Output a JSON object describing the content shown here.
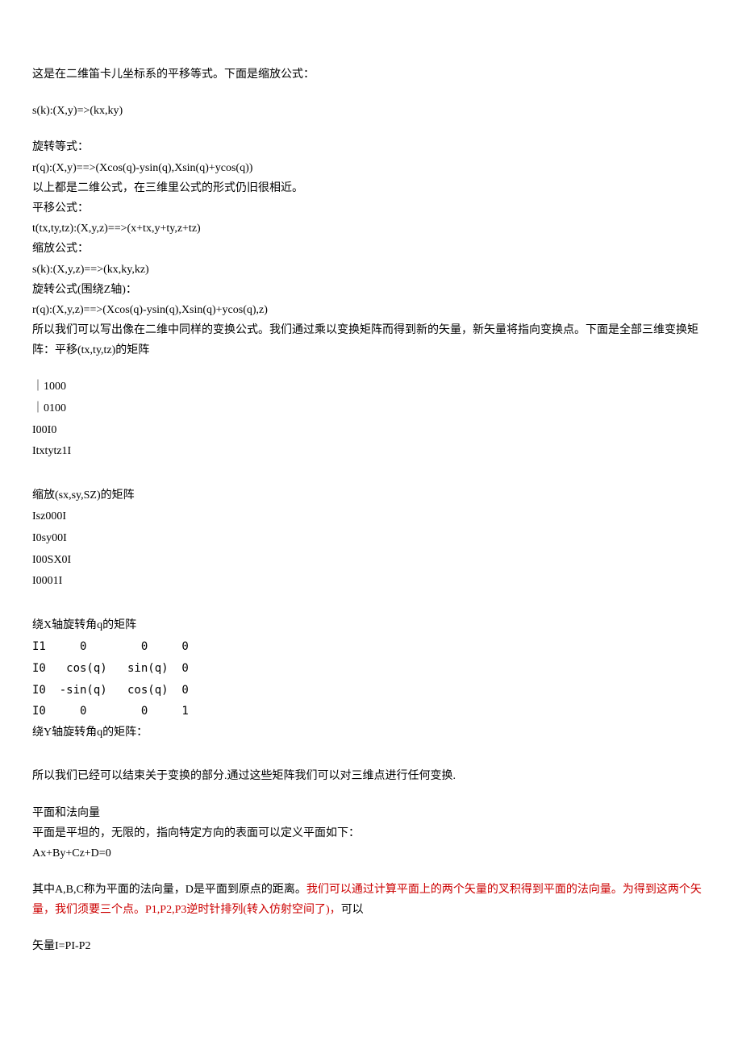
{
  "p1": "这是在二维笛卡儿坐标系的平移等式。下面是缩放公式：",
  "p2": "s(k):(X,y)=>(kx,ky)",
  "p3a": "旋转等式：",
  "p3b": "r(q):(X,y)==>(Xcos(q)-ysin(q),Xsin(q)+ycos(q))",
  "p3c": "以上都是二维公式，在三维里公式的形式仍旧很相近。",
  "p3d": "平移公式：",
  "p3e": "t(tx,ty,tz):(X,y,z)==>(x+tx,y+ty,z+tz)",
  "p3f": "缩放公式：",
  "p3g": "s(k):(X,y,z)==>(kx,ky,kz)",
  "p3h": "旋转公式(围绕Z轴)：",
  "p3i": "r(q):(X,y,z)==>(Xcos(q)-ysin(q),Xsin(q)+ycos(q),z)",
  "p3j": "所以我们可以写出像在二维中同样的变换公式。我们通过乘以变换矩阵而得到新的矢量，新矢量将指向变换点。下面是全部三维变换矩阵：平移(tx,ty,tz)的矩阵",
  "m1a": "｜1000",
  "m1b": "｜0100",
  "m1c": "I00I0",
  "m1d": "Itxtytz1I",
  "p4": "缩放(sx,sy,SZ)的矩阵",
  "m2a": "Isz000I",
  "m2b": "I0sy00I",
  "m2c": "I00SX0I",
  "m2d": "I0001I",
  "p5": "绕X轴旋转角q的矩阵",
  "m3a": "I1     0        0     0",
  "m3b": "I0   cos(q)   sin(q)  0",
  "m3c": "I0  -sin(q)   cos(q)  0",
  "m3d": "I0     0        0     1",
  "p6": "绕Y轴旋转角q的矩阵：",
  "p7": "所以我们已经可以结束关于变换的部分.通过这些矩阵我们可以对三维点进行任何变换.",
  "p8a": "平面和法向量",
  "p8b": "平面是平坦的，无限的，指向特定方向的表面可以定义平面如下：",
  "p8c": "Ax+By+Cz+D=0",
  "p9a": "其中A,B,C称为平面的法向量，D是平面到原点的距离。",
  "p9b": "我们可以通过计算平面上的两个矢量的叉积得到平面的法向量。为得到这两个矢量，我们须要三个点。P1,P2,P3逆时针排列(转入仿射空间了)，",
  "p9c": "可以",
  "p10": "矢量I=PI-P2"
}
